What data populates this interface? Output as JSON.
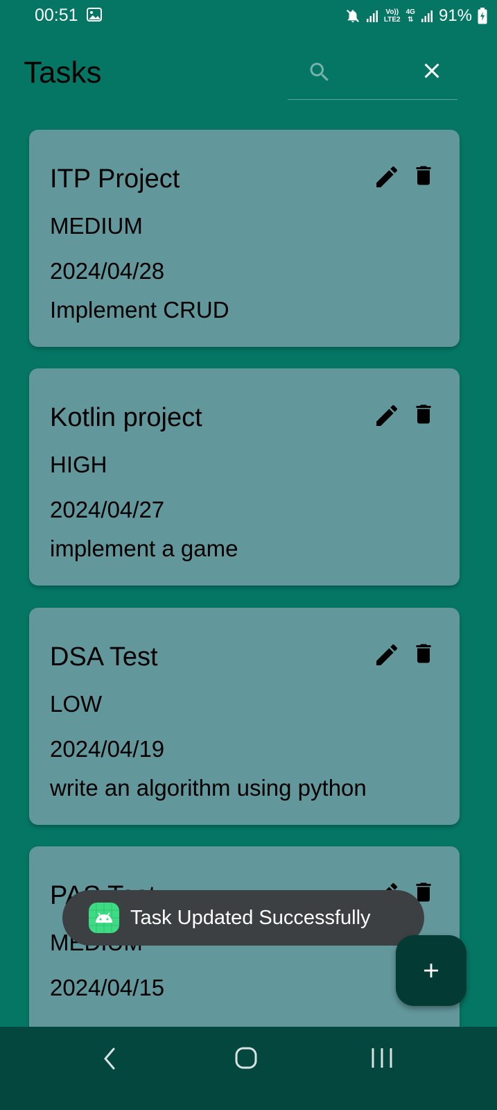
{
  "status_bar": {
    "time": "00:51",
    "battery": "91%",
    "network_top": "Vo))",
    "network_bottom": "LTE2",
    "network_type": "4G"
  },
  "header": {
    "title": "Tasks",
    "search_placeholder": ""
  },
  "tasks": [
    {
      "title": "ITP Project",
      "priority": "MEDIUM",
      "date": "2024/04/28",
      "description": "Implement CRUD"
    },
    {
      "title": "Kotlin project",
      "priority": "HIGH",
      "date": "2024/04/27",
      "description": "implement a game"
    },
    {
      "title": "DSA Test",
      "priority": "LOW",
      "date": "2024/04/19",
      "description": "write an algorithm using python"
    },
    {
      "title": "PAS Test",
      "priority": "MEDIUM",
      "date": "2024/04/15",
      "description": ""
    }
  ],
  "toast": {
    "message": "Task Updated Successfully"
  },
  "icons": {
    "search": "search-icon",
    "clear": "close-icon",
    "edit": "edit-icon",
    "delete": "delete-icon",
    "add": "add-icon",
    "back": "back-icon",
    "home": "home-icon",
    "recents": "recents-icon"
  },
  "colors": {
    "background": "#067664",
    "card": "#62979b",
    "toast": "#3c4043",
    "fab": "#033a33",
    "nav_bar": "#03473f"
  }
}
